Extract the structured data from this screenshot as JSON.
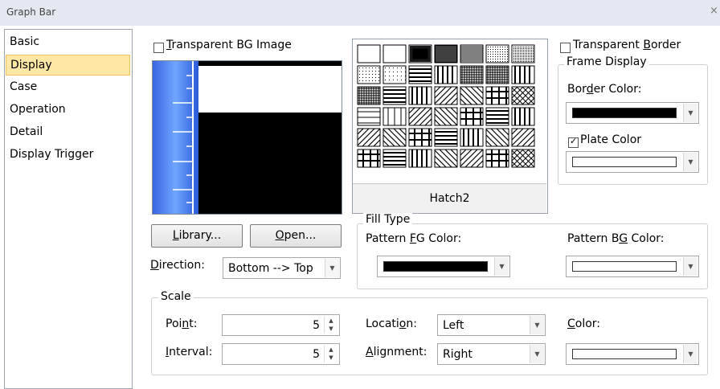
{
  "window": {
    "title": "Graph Bar",
    "close_glyph": "×"
  },
  "nav": {
    "items": [
      "Basic",
      "Display",
      "Case",
      "Operation",
      "Detail",
      "Display Trigger"
    ],
    "selected": "Display"
  },
  "display": {
    "transparent_bg_image": {
      "label_pre": "",
      "label_key": "T",
      "label_post": "ransparent BG Image",
      "checked": false
    },
    "library_button": {
      "key": "L",
      "rest": "ibrary..."
    },
    "open_button": {
      "key": "O",
      "rest": "pen..."
    },
    "direction": {
      "label_key": "D",
      "label_post": "irection:",
      "value": "Bottom --> Top"
    },
    "hatch": {
      "selected_name": "Hatch2"
    },
    "transparent_border": {
      "label_pre": "Transparent ",
      "label_key": "B",
      "label_post": "order",
      "checked": false
    },
    "frame_display": {
      "title": "Frame Display",
      "border_color": {
        "label_pre": "Bor",
        "label_key": "d",
        "label_post": "er Color:",
        "color": "#000000"
      },
      "plate_color": {
        "label": "Plate Color",
        "checked": true,
        "color": "#ffffff"
      }
    },
    "fill_type": {
      "title": "Fill Type",
      "pattern_fg": {
        "label_pre": "Pattern ",
        "label_key": "F",
        "label_post": "G Color:",
        "color": "#000000"
      },
      "pattern_bg": {
        "label_pre": "Pattern B",
        "label_key": "G",
        "label_post": " Color:",
        "color": "#ffffff"
      }
    },
    "scale": {
      "title": "Scale",
      "point": {
        "label_pre": "Poi",
        "label_key": "n",
        "label_post": "t:",
        "value": "5"
      },
      "interval": {
        "label_pre": "",
        "label_key": "I",
        "label_post": "nterval:",
        "value": "5"
      },
      "location": {
        "label_pre": "Locati",
        "label_key": "o",
        "label_post": "n:",
        "value": "Left"
      },
      "alignment": {
        "label_pre": "",
        "label_key": "A",
        "label_post": "lignment:",
        "value": "Right"
      },
      "color": {
        "label_pre": "",
        "label_key": "C",
        "label_post": "olor:",
        "color": "#ffffff"
      }
    }
  },
  "icons": {
    "dropdown": "chevron-down-icon",
    "spin": "spin-updown-icon",
    "checkbox": "checkbox-icon"
  }
}
